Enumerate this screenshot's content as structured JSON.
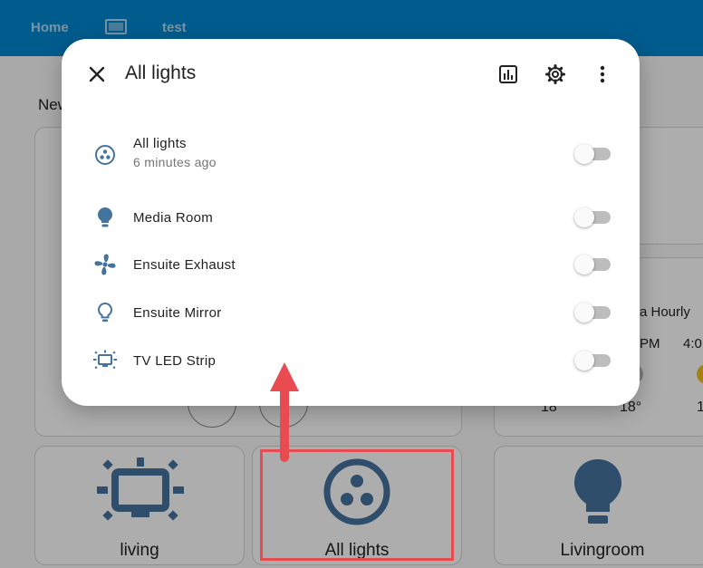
{
  "topbar": {
    "tabs": [
      {
        "label": "Home"
      },
      {
        "label": "test"
      }
    ],
    "tab_icon": "monitor-icon",
    "background": "#0288d1"
  },
  "dashboard": {
    "section_title": "New",
    "weather": {
      "title_fragment": "a Hourly",
      "times": [
        "PM",
        "4:0"
      ],
      "temps": [
        "18",
        "18°",
        "1"
      ]
    },
    "tiles": [
      {
        "label": "living",
        "icon": "tv-ambient-light-icon"
      },
      {
        "label": "All lights",
        "icon": "light-group-icon"
      },
      {
        "label": "Livingroom",
        "icon": "lightbulb-icon"
      }
    ]
  },
  "dialog": {
    "title": "All lights",
    "actions": [
      "history-chart-icon",
      "settings-gear-icon",
      "more-vertical-icon"
    ],
    "group": {
      "name": "All lights",
      "last_changed": "6 minutes ago",
      "icon": "light-group-icon",
      "state": "off"
    },
    "entities": [
      {
        "name": "Media Room",
        "icon": "lightbulb-icon",
        "state": "off"
      },
      {
        "name": "Ensuite Exhaust",
        "icon": "fan-icon",
        "state": "off"
      },
      {
        "name": "Ensuite Mirror",
        "icon": "lightbulb-outline-icon",
        "state": "off"
      },
      {
        "name": "TV LED Strip",
        "icon": "tv-ambient-light-icon",
        "state": "off"
      }
    ]
  },
  "colors": {
    "icon": "#44739e",
    "annotation": "#e84c50"
  }
}
